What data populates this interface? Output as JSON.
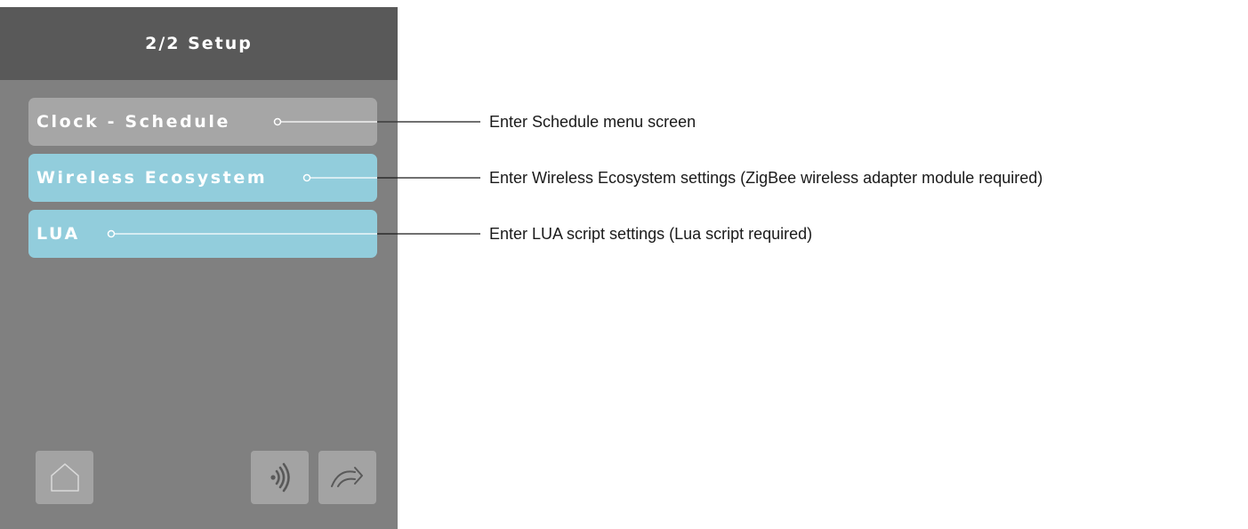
{
  "screen": {
    "title": "2/2 Setup",
    "menu_items": [
      {
        "label": "Clock - Schedule",
        "style": "gray",
        "color": "#a6a6a6"
      },
      {
        "label": "Wireless Ecosystem",
        "style": "blue",
        "color": "#92cddc"
      },
      {
        "label": "LUA",
        "style": "blue",
        "color": "#92cddc"
      }
    ],
    "footer": {
      "left_icon": "home-icon",
      "right_icons": [
        "wireless-signal-icon",
        "next-arrow-icon"
      ]
    },
    "colors": {
      "header": "#595959",
      "background": "#808080",
      "button": "#a3a3a3"
    }
  },
  "annotations": [
    "Enter Schedule menu screen",
    "Enter Wireless Ecosystem settings (ZigBee wireless adapter module required)",
    "Enter LUA script settings (Lua script required)"
  ]
}
